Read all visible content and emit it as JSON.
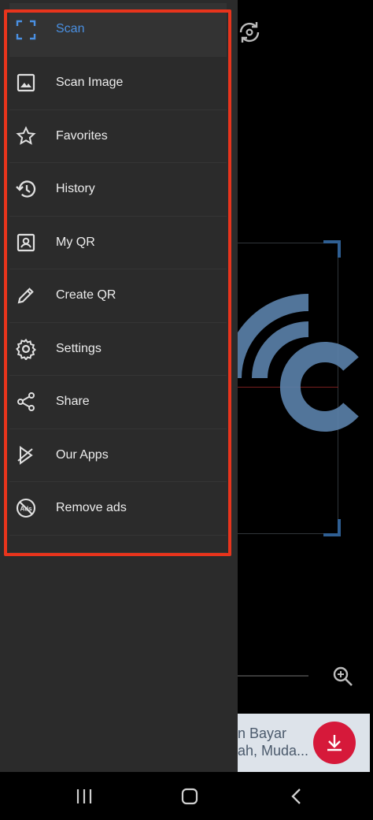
{
  "drawer": {
    "items": [
      {
        "label": "Scan",
        "icon": "scan-frame-icon",
        "active": true
      },
      {
        "label": "Scan Image",
        "icon": "image-icon"
      },
      {
        "label": "Favorites",
        "icon": "star-icon"
      },
      {
        "label": "History",
        "icon": "history-icon"
      },
      {
        "label": "My QR",
        "icon": "contact-card-icon"
      },
      {
        "label": "Create QR",
        "icon": "pencil-icon"
      },
      {
        "label": "Settings",
        "icon": "gear-icon"
      },
      {
        "label": "Share",
        "icon": "share-icon"
      },
      {
        "label": "Our Apps",
        "icon": "apps-icon"
      },
      {
        "label": "Remove ads",
        "icon": "no-ads-icon"
      }
    ]
  },
  "ad": {
    "text_line1": "n Bayar",
    "text_line2": "ah, Muda..."
  },
  "colors": {
    "accent": "#4a90e2",
    "highlight": "#e8341c",
    "drawer_bg": "#2b2b2b"
  }
}
